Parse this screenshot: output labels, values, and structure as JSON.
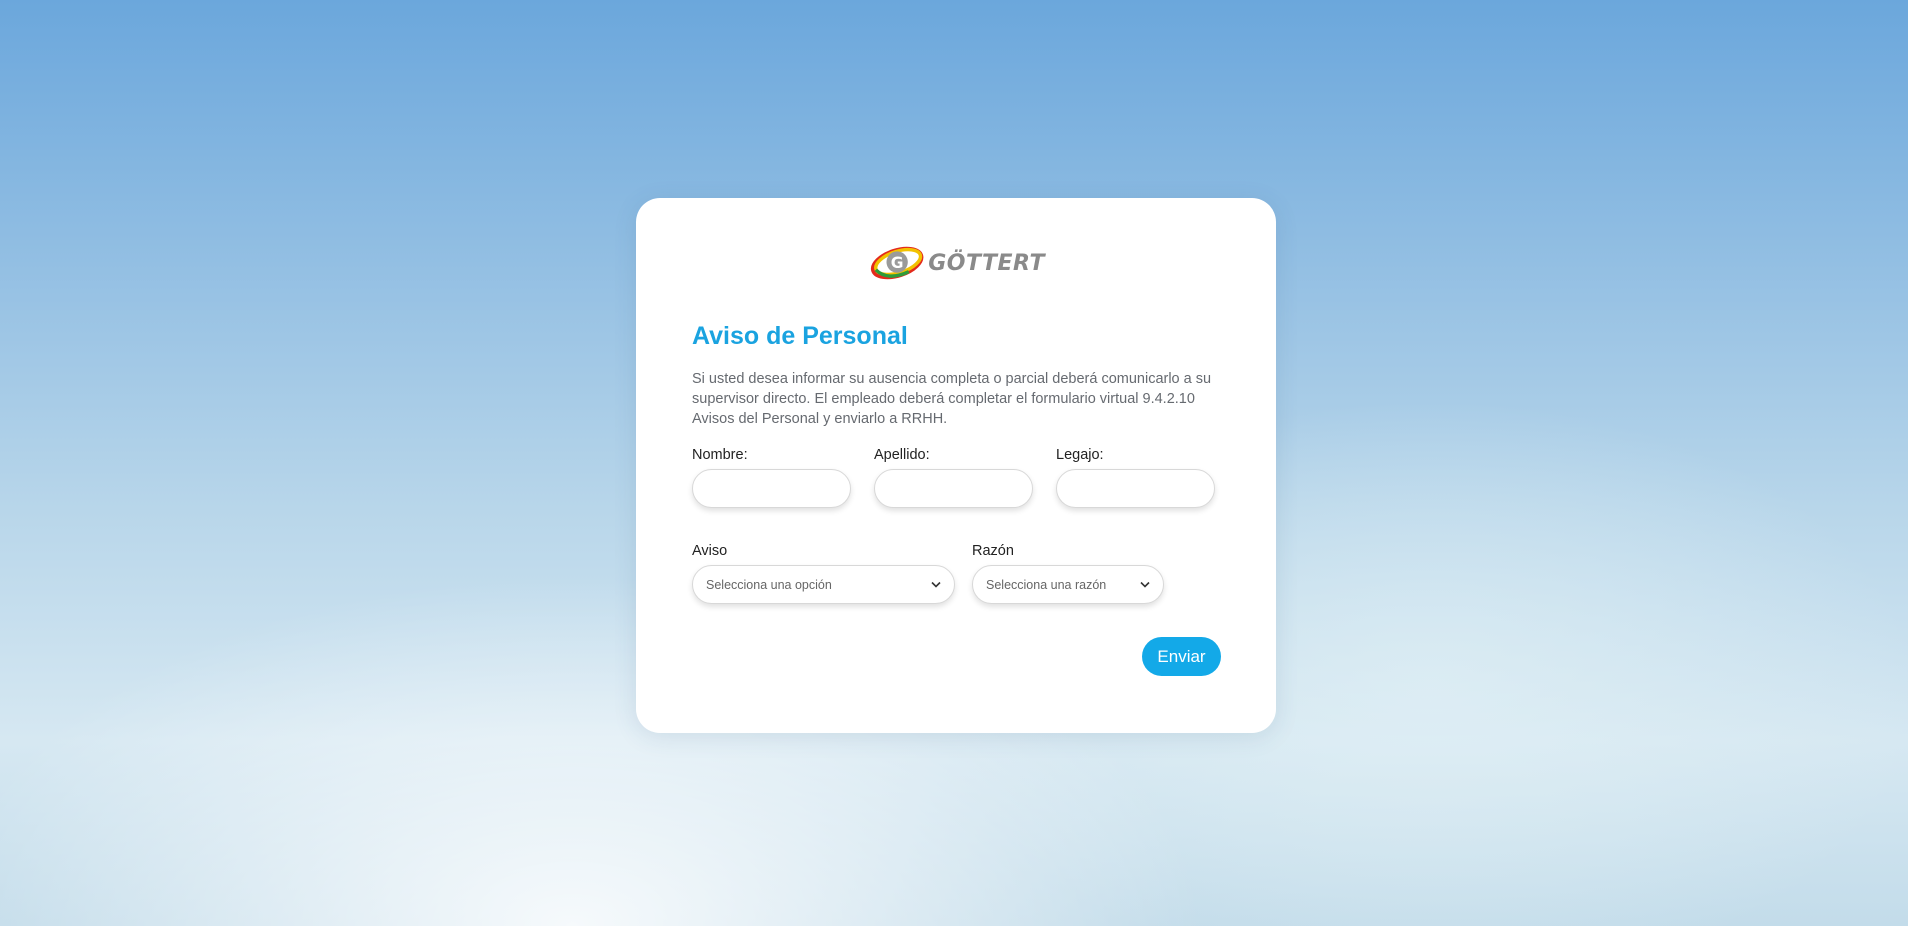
{
  "brand": {
    "name": "GÖTTERT",
    "logo_letter": "G"
  },
  "form": {
    "title": "Aviso de Personal",
    "description": "Si usted desea informar su ausencia completa o parcial deberá comunicarlo a su supervisor directo. El empleado deberá completar el formulario virtual 9.4.2.10 Avisos del Personal y enviarlo a RRHH.",
    "fields": {
      "nombre": {
        "label": "Nombre:",
        "value": ""
      },
      "apellido": {
        "label": "Apellido:",
        "value": ""
      },
      "legajo": {
        "label": "Legajo:",
        "value": ""
      }
    },
    "aviso": {
      "label": "Aviso",
      "selected": "Selecciona una opción"
    },
    "razon": {
      "label": "Razón",
      "selected": "Selecciona una razón"
    },
    "submit_label": "Enviar"
  },
  "colors": {
    "accent": "#13a9e8",
    "title": "#1aa3e0"
  }
}
